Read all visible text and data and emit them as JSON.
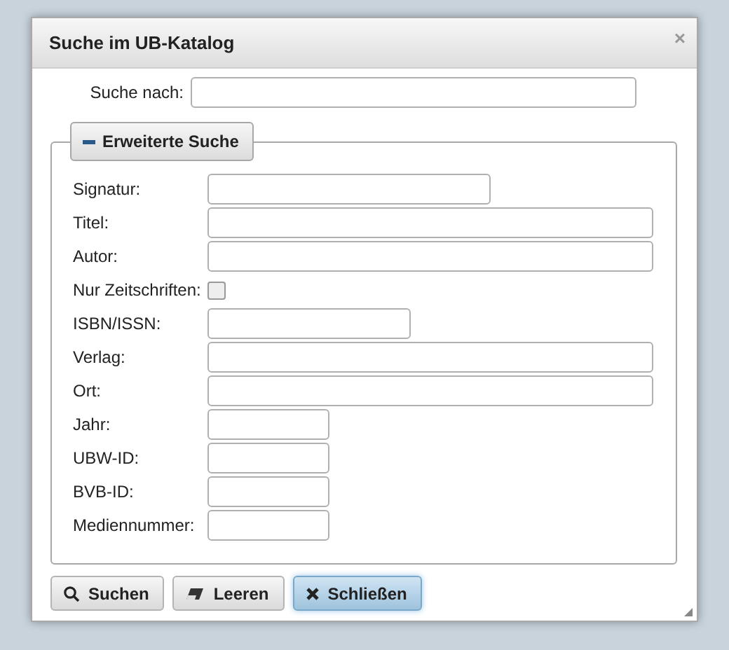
{
  "dialog": {
    "title": "Suche im UB-Katalog",
    "close": "×"
  },
  "search": {
    "label": "Suche nach:"
  },
  "advanced": {
    "legend": "Erweiterte Suche",
    "expanded": true,
    "fields": [
      {
        "label": "Signatur:",
        "kind": "short"
      },
      {
        "label": "Titel:",
        "kind": "full"
      },
      {
        "label": "Autor:",
        "kind": "full"
      },
      {
        "label": "Nur Zeitschriften:",
        "kind": "checkbox",
        "checked": false
      },
      {
        "label": "ISBN/ISSN:",
        "kind": "medium"
      },
      {
        "label": "Verlag:",
        "kind": "full"
      },
      {
        "label": "Ort:",
        "kind": "full"
      },
      {
        "label": "Jahr:",
        "kind": "tiny"
      },
      {
        "label": "UBW-ID:",
        "kind": "tiny"
      },
      {
        "label": "BVB-ID:",
        "kind": "tiny"
      },
      {
        "label": "Mediennummer:",
        "kind": "tiny"
      }
    ]
  },
  "buttons": [
    {
      "label": "Suchen",
      "kind": "search",
      "selected": false
    },
    {
      "label": "Leeren",
      "kind": "erase",
      "selected": false
    },
    {
      "label": "Schließen",
      "kind": "close",
      "selected": true
    }
  ]
}
